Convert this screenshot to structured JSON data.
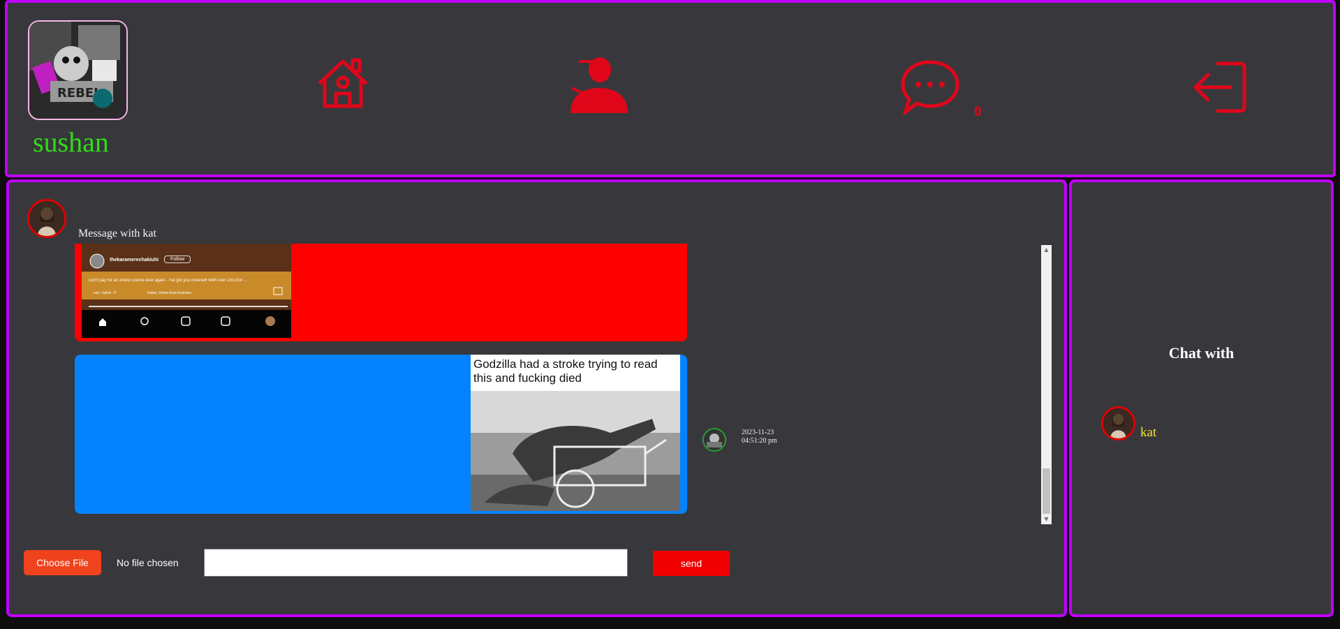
{
  "header": {
    "username": "sushan",
    "nav": [
      {
        "name": "home",
        "icon": "house-icon"
      },
      {
        "name": "friends",
        "icon": "user-icon"
      },
      {
        "name": "messages",
        "icon": "chat-bubble-icon"
      },
      {
        "name": "logout",
        "icon": "logout-icon"
      }
    ],
    "message_count": "0"
  },
  "chat": {
    "title": "Message with kat",
    "messages": [
      {
        "type": "image",
        "preview": {
          "account": "thekaramerechakiuhi",
          "follow_label": "Follow",
          "caption": "Don't pay for an online course ever again - I've got you covered! With over 200,000 ...",
          "audio": "· vuk • Isdod · P",
          "location": "Dubai, United Arab Emirates"
        }
      },
      {
        "type": "image",
        "caption": "Godzilla had a stroke trying to read this and fucking died",
        "date": "2023-11-23",
        "time": "04:51:20 pm"
      }
    ],
    "file_button": "Choose File",
    "file_status": "No file chosen",
    "send_label": "send"
  },
  "sidebar": {
    "title": "Chat with",
    "contacts": [
      {
        "name": "kat"
      }
    ]
  },
  "colors": {
    "border": "#bf00ff",
    "panel": "#38383c",
    "icon_red": "#e0061a",
    "username_green": "#32dc14",
    "contact_yellow": "#f4e22a",
    "bubble_red": "#ff0000",
    "bubble_blue": "#0383ff"
  }
}
